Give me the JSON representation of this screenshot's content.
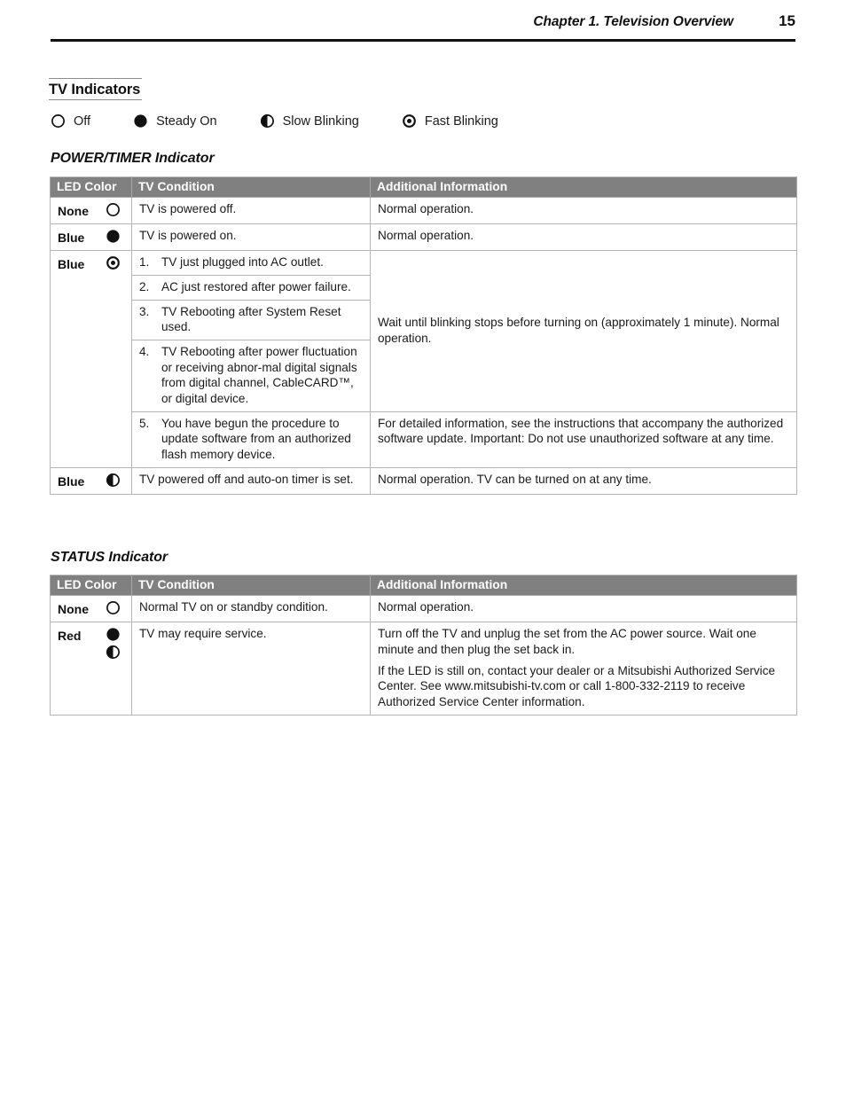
{
  "header": {
    "title": "Chapter 1. Television Overview",
    "page_number": "15"
  },
  "section": {
    "heading": "TV Indicators"
  },
  "legend": {
    "items": [
      {
        "icon": "led-off-icon",
        "label": "Off"
      },
      {
        "icon": "led-steady-on-icon",
        "label": "Steady On"
      },
      {
        "icon": "led-slow-blinking-icon",
        "label": "Slow Blinking"
      },
      {
        "icon": "led-fast-blinking-icon",
        "label": "Fast Blinking"
      }
    ]
  },
  "power_timer": {
    "heading": "POWER/TIMER Indicator",
    "columns": [
      "LED Color",
      "TV Condition",
      "Additional Information"
    ],
    "rows": {
      "r1": {
        "color": "None",
        "icon": "led-off-icon",
        "condition": "TV is powered off.",
        "info": "Normal operation."
      },
      "r2": {
        "color": "Blue",
        "icon": "led-steady-on-icon",
        "condition": "TV is powered on.",
        "info": "Normal operation."
      },
      "r3": {
        "color": "Blue",
        "icon": "led-fast-blinking-icon",
        "items": [
          {
            "num": "1.",
            "text": "TV just plugged into AC outlet."
          },
          {
            "num": "2.",
            "text": "AC just restored after power failure."
          },
          {
            "num": "3.",
            "text": "TV Rebooting after System Reset used."
          },
          {
            "num": "4.",
            "text": "TV Rebooting after power fluctuation or receiving abnor-mal digital signals from digital channel, CableCARD™, or digital device."
          },
          {
            "num": "5.",
            "text": "You have begun the procedure to update software from an authorized flash memory device."
          }
        ],
        "info_1_4": "Wait until blinking stops before turning on (approximately 1 minute).  Normal operation.",
        "info_5": "For detailed information, see the instructions that accompany the authorized software update.  Important:  Do not use unauthorized software at any time."
      },
      "r4": {
        "color": "Blue",
        "icon": "led-slow-blinking-icon",
        "condition": "TV powered off and auto-on timer is set.",
        "info": "Normal operation.  TV can be turned on at any time."
      }
    }
  },
  "status": {
    "heading": "STATUS Indicator",
    "columns": [
      "LED Color",
      "TV Condition",
      "Additional Information"
    ],
    "rows": {
      "r1": {
        "color": "None",
        "icon": "led-off-icon",
        "condition": "Normal TV on or standby condition.",
        "info": "Normal operation."
      },
      "r2": {
        "color": "Red",
        "icons": [
          "led-steady-on-icon",
          "led-slow-blinking-icon"
        ],
        "condition": "TV may require service.",
        "info_p1": "Turn off the TV and unplug the set from the AC power source.  Wait one minute and then plug the set back in.",
        "info_p2": "If the LED is still on, contact your dealer or a Mitsubishi Authorized Service Center.  See www.mitsubishi-tv.com or call 1-800-332-2119 to receive Authorized Service Center information."
      }
    }
  },
  "colors": {
    "header_gray": "#808080",
    "rule_black": "#111111",
    "border_gray": "#b5b5b5",
    "heading_rule": "#8c8c8c"
  }
}
